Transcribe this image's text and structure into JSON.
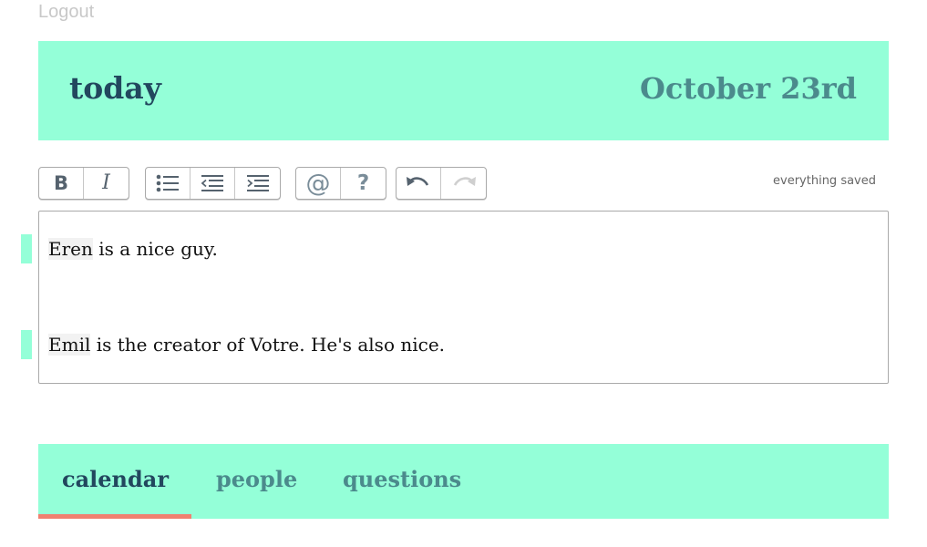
{
  "nav": {
    "logout_label": "Logout"
  },
  "header": {
    "title": "today",
    "date": "October 23rd"
  },
  "toolbar": {
    "bold_label": "B",
    "italic_label": "I",
    "mention_label": "@",
    "help_label": "?",
    "status": "everything saved"
  },
  "editor": {
    "lines": [
      {
        "mention": "Eren",
        "text": " is a nice guy."
      },
      {
        "mention": "Emil",
        "text": " is the creator of Votre. He's also nice."
      }
    ]
  },
  "tabs": [
    {
      "label": "calendar",
      "active": true
    },
    {
      "label": "people",
      "active": false
    },
    {
      "label": "questions",
      "active": false
    }
  ],
  "colors": {
    "accent": "#94ffd8",
    "active_tab_underline": "#f08070",
    "title_text": "#22475e",
    "secondary_text": "#4b8a8c"
  }
}
